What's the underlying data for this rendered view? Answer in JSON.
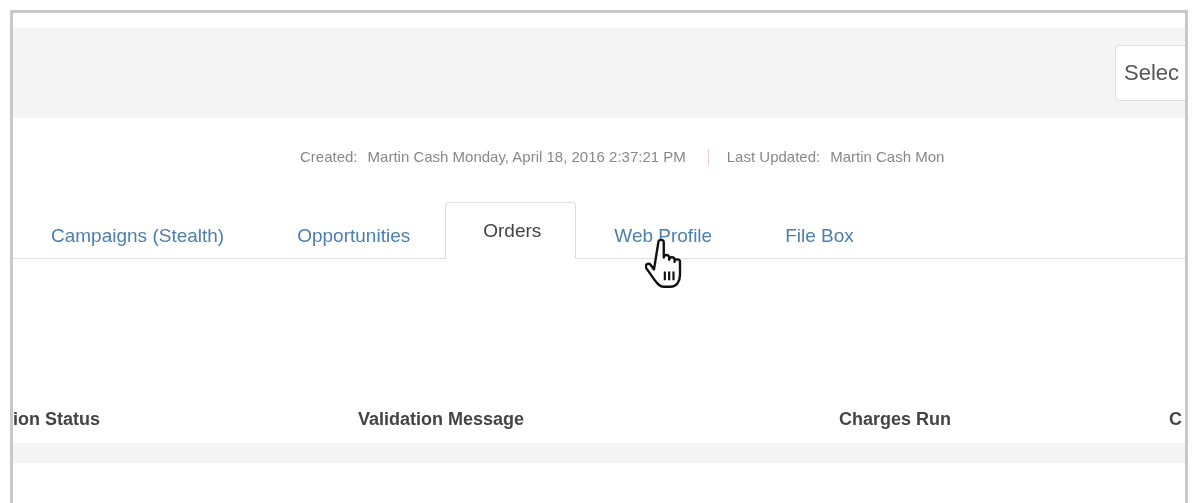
{
  "header": {
    "select": {
      "placeholder": "Selec"
    }
  },
  "meta": {
    "created_label": "Created:",
    "created_value": "Martin Cash Monday, April 18, 2016 2:37:21 PM",
    "updated_label": "Last Updated:",
    "updated_value": "Martin Cash Mon"
  },
  "tabs": [
    {
      "label": "Campaigns (Stealth)",
      "selected": false
    },
    {
      "label": "Opportunities",
      "selected": false
    },
    {
      "label": "Orders",
      "selected": true
    },
    {
      "label": "Web Profile",
      "selected": false
    },
    {
      "label": "File Box",
      "selected": false
    }
  ],
  "table": {
    "columns": [
      "ion Status",
      "Validation Message",
      "Charges Run",
      "C"
    ]
  }
}
